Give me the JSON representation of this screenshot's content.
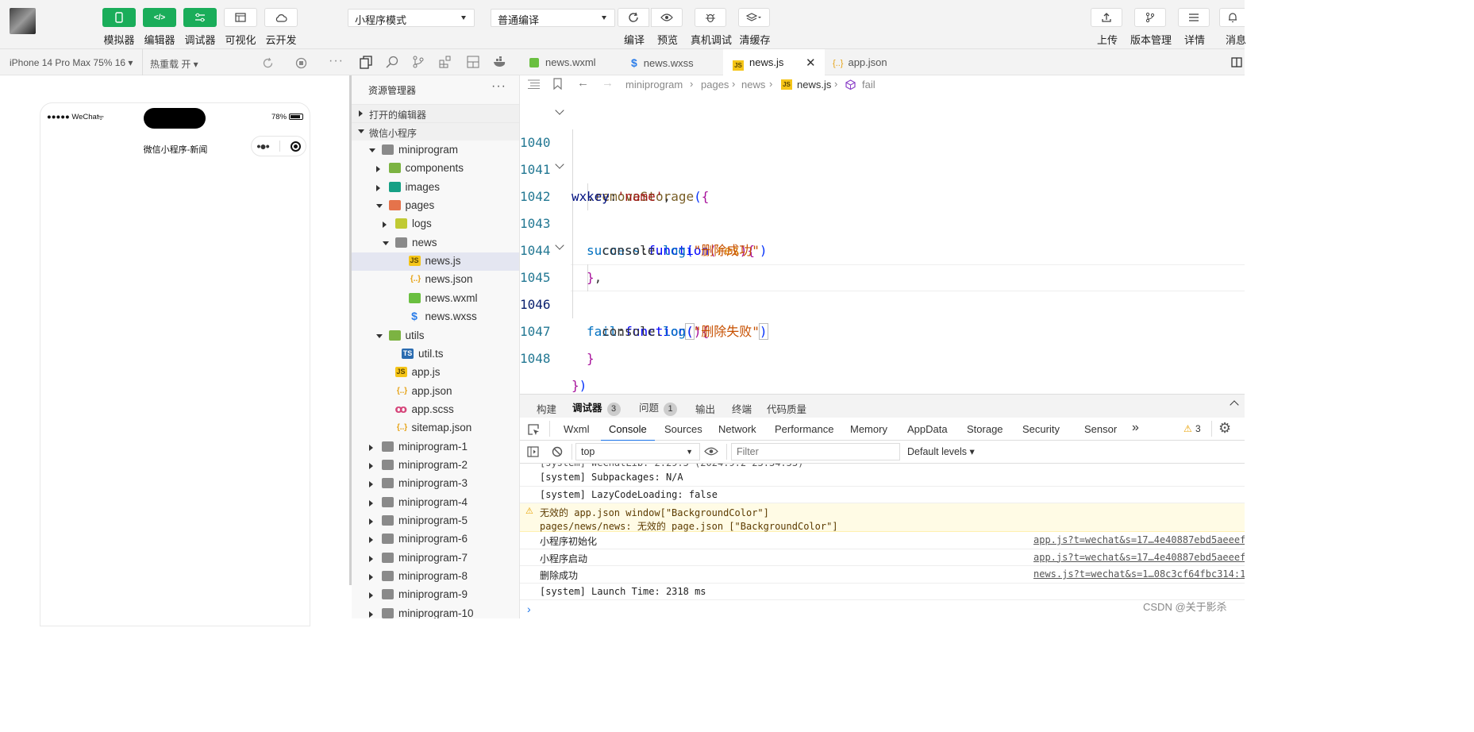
{
  "toolbar": {
    "left_buttons": [
      {
        "label": "模拟器",
        "icon": "phone-icon"
      },
      {
        "label": "编辑器",
        "icon": "code-icon"
      },
      {
        "label": "调试器",
        "icon": "sliders-icon"
      },
      {
        "label": "可视化",
        "icon": "layout-icon"
      },
      {
        "label": "云开发",
        "icon": "cloud-icon"
      }
    ],
    "mode_select": "小程序模式",
    "compile_select": "普通编译",
    "middle_buttons": [
      {
        "label": "编译",
        "icon": "refresh-icon"
      },
      {
        "label": "预览",
        "icon": "eye-icon"
      },
      {
        "label": "真机调试",
        "icon": "bug-icon"
      },
      {
        "label": "清缓存",
        "icon": "layers-icon"
      }
    ],
    "right_buttons": [
      {
        "label": "上传",
        "icon": "upload-icon"
      },
      {
        "label": "版本管理",
        "icon": "branch-icon"
      },
      {
        "label": "详情",
        "icon": "menu-icon"
      },
      {
        "label": "消息",
        "icon": "bell-icon"
      }
    ]
  },
  "simulator": {
    "device": "iPhone 14 Pro Max 75% 16 ▾",
    "hot_reload": "热重载 开 ▾",
    "status_left": "●●●●● WeChat",
    "battery": "78%",
    "page_title": "微信小程序-新闻"
  },
  "explorer": {
    "title": "资源管理器",
    "open_editors": "打开的编辑器",
    "project": "微信小程序",
    "tree": [
      {
        "label": "miniprogram",
        "depth": 0,
        "type": "folder",
        "open": true
      },
      {
        "label": "components",
        "depth": 1,
        "type": "folder",
        "open": false
      },
      {
        "label": "images",
        "depth": 1,
        "type": "folder",
        "open": false
      },
      {
        "label": "pages",
        "depth": 1,
        "type": "folder",
        "open": true
      },
      {
        "label": "logs",
        "depth": 2,
        "type": "folder",
        "open": false
      },
      {
        "label": "news",
        "depth": 2,
        "type": "folder",
        "open": true
      },
      {
        "label": "news.js",
        "depth": 3,
        "type": "js",
        "active": true
      },
      {
        "label": "news.json",
        "depth": 3,
        "type": "json"
      },
      {
        "label": "news.wxml",
        "depth": 3,
        "type": "wxml"
      },
      {
        "label": "news.wxss",
        "depth": 3,
        "type": "wxss"
      },
      {
        "label": "utils",
        "depth": 1,
        "type": "folder",
        "open": true
      },
      {
        "label": "util.ts",
        "depth": 2,
        "type": "ts"
      },
      {
        "label": "app.js",
        "depth": 1,
        "type": "js"
      },
      {
        "label": "app.json",
        "depth": 1,
        "type": "json"
      },
      {
        "label": "app.scss",
        "depth": 1,
        "type": "scss"
      },
      {
        "label": "sitemap.json",
        "depth": 1,
        "type": "json"
      },
      {
        "label": "miniprogram-1",
        "depth": 0,
        "type": "folder",
        "open": false
      },
      {
        "label": "miniprogram-2",
        "depth": 0,
        "type": "folder",
        "open": false
      },
      {
        "label": "miniprogram-3",
        "depth": 0,
        "type": "folder",
        "open": false
      },
      {
        "label": "miniprogram-4",
        "depth": 0,
        "type": "folder",
        "open": false
      },
      {
        "label": "miniprogram-5",
        "depth": 0,
        "type": "folder",
        "open": false
      },
      {
        "label": "miniprogram-6",
        "depth": 0,
        "type": "folder",
        "open": false
      },
      {
        "label": "miniprogram-7",
        "depth": 0,
        "type": "folder",
        "open": false
      },
      {
        "label": "miniprogram-8",
        "depth": 0,
        "type": "folder",
        "open": false
      },
      {
        "label": "miniprogram-9",
        "depth": 0,
        "type": "folder",
        "open": false
      },
      {
        "label": "miniprogram-10",
        "depth": 0,
        "type": "folder",
        "open": false
      }
    ]
  },
  "editor": {
    "tabs": [
      {
        "label": "news.wxml",
        "type": "wxml"
      },
      {
        "label": "news.wxss",
        "type": "wxss"
      },
      {
        "label": "news.js",
        "type": "js",
        "active": true
      },
      {
        "label": "app.json",
        "type": "json"
      }
    ],
    "breadcrumb": [
      "miniprogram",
      "pages",
      "news",
      "news.js",
      "fail"
    ],
    "line_numbers": [
      "1040",
      "1041",
      "1042",
      "1043",
      "1044",
      "1045",
      "1046",
      "1047",
      "1048"
    ],
    "code": {
      "l1040_obj": "wx",
      "l1040_fn": "removeStorage",
      "l1041_key": "key",
      "l1041_val": "'name'",
      "l1042_key": "success",
      "l1042_kw": "function",
      "l1042_param": "res",
      "l1043_obj": "console",
      "l1043_fn": "log",
      "l1043_str": "\"删除成功\"",
      "l1045_key": "fail",
      "l1045_kw": "function",
      "l1046_obj": "console",
      "l1046_fn": "log",
      "l1046_str": "\"删除失败\""
    }
  },
  "panel": {
    "tabs": [
      {
        "label": "构建"
      },
      {
        "label": "调试器",
        "badge": "3",
        "active": true
      },
      {
        "label": "问题",
        "badge": "1"
      },
      {
        "label": "输出"
      },
      {
        "label": "终端"
      },
      {
        "label": "代码质量"
      }
    ],
    "devtools_tabs": [
      "Wxml",
      "Console",
      "Sources",
      "Network",
      "Performance",
      "Memory",
      "AppData",
      "Storage",
      "Security",
      "Sensor"
    ],
    "devtools_active": "Console",
    "more": "»",
    "warning_count": "3",
    "context": "top",
    "filter_placeholder": "Filter",
    "levels": "Default levels ▾",
    "console_lines": [
      {
        "text": "[system] Subpackages: N/A",
        "mono": true
      },
      {
        "text": "[system] LazyCodeLoading: false",
        "mono": true
      },
      {
        "text": "无效的 app.json window[\"BackgroundColor\"]",
        "text2": "pages/news/news: 无效的 page.json [\"BackgroundColor\"]",
        "warn": true
      },
      {
        "text": "小程序初始化",
        "source": "app.js?t=wechat&s=17…4e40887ebd5aeeef4:4"
      },
      {
        "text": "小程序启动",
        "source": "app.js?t=wechat&s=17…4e40887ebd5aeeef4:7"
      },
      {
        "text": "删除成功",
        "source": "news.js?t=wechat&s=1…08c3cf64fbc314:1043"
      },
      {
        "text": "[system] Launch Time: 2318 ms",
        "mono": true
      }
    ],
    "prompt": "›"
  },
  "watermark": "CSDN @关于影杀",
  "colors": {
    "accent_green": "#1aad5a",
    "link_blue": "#1a73e8"
  }
}
